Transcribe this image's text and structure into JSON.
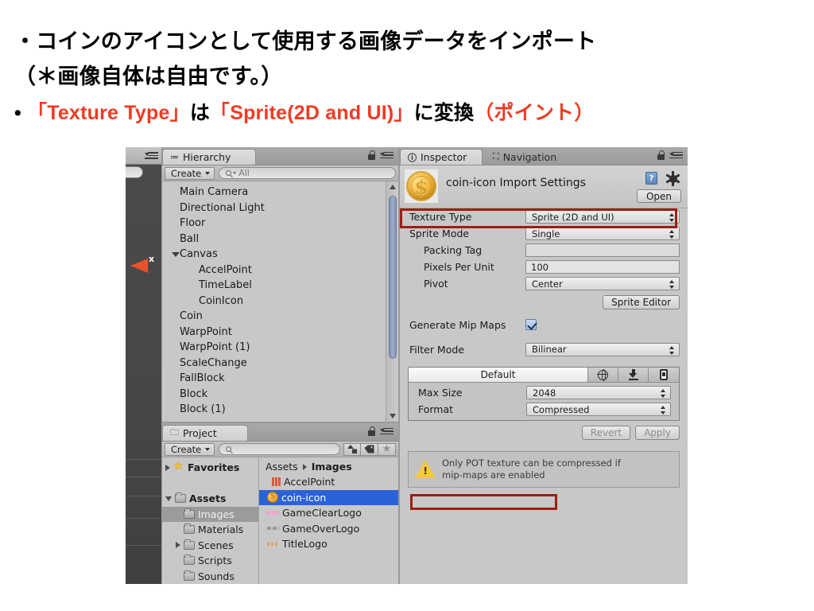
{
  "slide": {
    "line1": "・コインのアイコンとして使用する画像データをインポート",
    "line2": "（＊画像自体は自由です。）",
    "line3_bullet": "•",
    "line3_a": "「Texture Type」",
    "line3_b": "は",
    "line3_c": "「Sprite(2D and UI)」",
    "line3_d": "に変換",
    "line3_e": "（ポイント）",
    "accent_color": "#ef3b24"
  },
  "hierarchy": {
    "tab_label": "Hierarchy",
    "create_label": "Create",
    "search_placeholder": "All",
    "items": [
      {
        "label": "Main Camera",
        "depth": 0,
        "fold": "none"
      },
      {
        "label": "Directional Light",
        "depth": 0,
        "fold": "none"
      },
      {
        "label": "Floor",
        "depth": 0,
        "fold": "none"
      },
      {
        "label": "Ball",
        "depth": 0,
        "fold": "none"
      },
      {
        "label": "Canvas",
        "depth": 0,
        "fold": "down"
      },
      {
        "label": "AccelPoint",
        "depth": 1,
        "fold": "none"
      },
      {
        "label": "TimeLabel",
        "depth": 1,
        "fold": "none"
      },
      {
        "label": "CoinIcon",
        "depth": 1,
        "fold": "none"
      },
      {
        "label": "Coin",
        "depth": 0,
        "fold": "none"
      },
      {
        "label": "WarpPoint",
        "depth": 0,
        "fold": "none"
      },
      {
        "label": "WarpPoint (1)",
        "depth": 0,
        "fold": "none"
      },
      {
        "label": "ScaleChange",
        "depth": 0,
        "fold": "none"
      },
      {
        "label": "FallBlock",
        "depth": 0,
        "fold": "none"
      },
      {
        "label": "Block",
        "depth": 0,
        "fold": "none"
      },
      {
        "label": "Block (1)",
        "depth": 0,
        "fold": "none"
      }
    ]
  },
  "project": {
    "tab_label": "Project",
    "create_label": "Create",
    "search_placeholder": "",
    "tree": [
      {
        "label": "Favorites",
        "icon": "star-icon",
        "fold": "right",
        "indent": 0,
        "bold": true,
        "selected": false
      },
      {
        "label": "",
        "icon": "none",
        "fold": "none",
        "indent": 0,
        "bold": false,
        "selected": false
      },
      {
        "label": "Assets",
        "icon": "folder-icon",
        "fold": "down",
        "indent": 0,
        "bold": true,
        "selected": false
      },
      {
        "label": "Images",
        "icon": "folder-icon",
        "fold": "none",
        "indent": 1,
        "bold": false,
        "selected": true
      },
      {
        "label": "Materials",
        "icon": "folder-icon",
        "fold": "none",
        "indent": 1,
        "bold": false,
        "selected": false
      },
      {
        "label": "Scenes",
        "icon": "folder-icon",
        "fold": "right",
        "indent": 1,
        "bold": false,
        "selected": false
      },
      {
        "label": "Scripts",
        "icon": "folder-icon",
        "fold": "none",
        "indent": 1,
        "bold": false,
        "selected": false
      },
      {
        "label": "Sounds",
        "icon": "folder-icon",
        "fold": "none",
        "indent": 1,
        "bold": false,
        "selected": false
      }
    ],
    "breadcrumb_root": "Assets",
    "breadcrumb_current": "Images",
    "files": [
      {
        "label": "AccelPoint",
        "thumb": "accel-thumb",
        "fold": false,
        "selected": false
      },
      {
        "label": "coin-icon",
        "thumb": "coin-thumb",
        "fold": true,
        "selected": true
      },
      {
        "label": "GameClearLogo",
        "thumb": "pink-thumb",
        "fold": true,
        "selected": false
      },
      {
        "label": "GameOverLogo",
        "thumb": "gray-thumb",
        "fold": true,
        "selected": false
      },
      {
        "label": "TitleLogo",
        "thumb": "orange-thumb",
        "fold": true,
        "selected": false
      }
    ]
  },
  "inspector": {
    "tab_label": "Inspector",
    "tab_nav_label": "Navigation",
    "title": "coin-icon Import Settings",
    "open_button": "Open",
    "properties": [
      {
        "label": "Texture Type",
        "value": "Sprite (2D and UI)",
        "control": "dropdown",
        "indent": false
      },
      {
        "label": "Sprite Mode",
        "value": "Single",
        "control": "dropdown",
        "indent": false
      },
      {
        "label": "Packing Tag",
        "value": "",
        "control": "textfield-empty",
        "indent": true
      },
      {
        "label": "Pixels Per Unit",
        "value": "100",
        "control": "textfield",
        "indent": true
      },
      {
        "label": "Pivot",
        "value": "Center",
        "control": "dropdown",
        "indent": true
      }
    ],
    "sprite_editor_button": "Sprite Editor",
    "generate_mip_maps": {
      "label": "Generate Mip Maps",
      "checked": true
    },
    "filter_mode": {
      "label": "Filter Mode",
      "value": "Bilinear"
    },
    "platform_tabs": [
      {
        "label": "Default",
        "icon": "none",
        "active": true
      },
      {
        "label": "",
        "icon": "globe-icon",
        "active": false
      },
      {
        "label": "",
        "icon": "download-icon",
        "active": false
      },
      {
        "label": "",
        "icon": "mobile-icon",
        "active": false
      }
    ],
    "platform_properties": [
      {
        "label": "Max Size",
        "value": "2048"
      },
      {
        "label": "Format",
        "value": "Compressed"
      }
    ],
    "revert_button": "Revert",
    "apply_button": "Apply",
    "warning_line1": "Only POT texture can be compressed if",
    "warning_line2": "mip-maps are enabled"
  },
  "highlight_color": "#9c1f12"
}
